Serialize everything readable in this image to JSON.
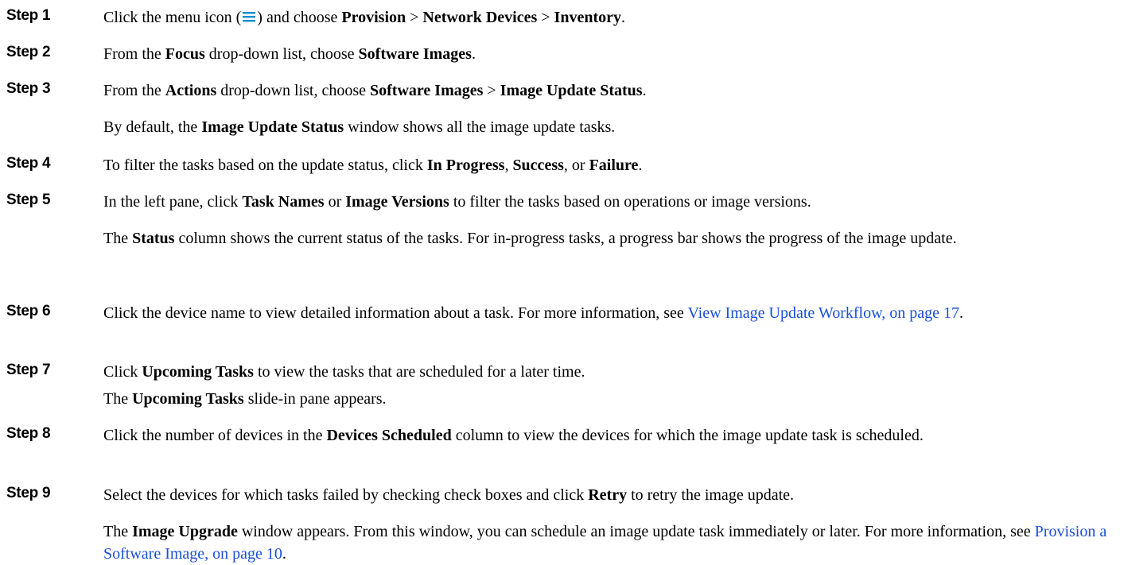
{
  "colors": {
    "text": "#000000",
    "link": "#1a4fd8",
    "menu_icon": "#0b8fd3"
  },
  "steps": [
    {
      "label": "Step 1",
      "p1": {
        "t1": "Click the menu icon (",
        "icon": "menu-icon",
        "t2": ") and choose ",
        "b1": "Provision",
        "t3": " > ",
        "b2": "Network Devices",
        "t4": " > ",
        "b3": "Inventory",
        "t5": "."
      }
    },
    {
      "label": "Step 2",
      "p1": {
        "t1": "From the ",
        "b1": "Focus",
        "t2": " drop-down list, choose ",
        "b2": "Software Images",
        "t3": "."
      }
    },
    {
      "label": "Step 3",
      "p1": {
        "t1": "From the ",
        "b1": "Actions",
        "t2": " drop-down list, choose ",
        "b2": "Software Images",
        "t3": " > ",
        "b3": "Image Update Status",
        "t4": "."
      },
      "p2": {
        "t1": "By default, the ",
        "b1": "Image Update Status",
        "t2": " window shows all the image update tasks."
      }
    },
    {
      "label": "Step 4",
      "p1": {
        "t1": "To filter the tasks based on the update status, click ",
        "b1": "In Progress",
        "t2": ", ",
        "b2": "Success",
        "t3": ", or ",
        "b3": "Failure",
        "t4": "."
      }
    },
    {
      "label": "Step 5",
      "p1": {
        "t1": "In the left pane, click ",
        "b1": "Task Names",
        "t2": " or ",
        "b2": "Image Versions",
        "t3": " to filter the tasks based on operations or image versions."
      },
      "p2": {
        "t1": "The ",
        "b1": "Status",
        "t2": " column shows the current status of the tasks. For in-progress tasks, a progress bar shows the progress of the image update."
      }
    },
    {
      "label": "Step 6",
      "p1": {
        "t1": "Click the device name to view detailed information about a task. For more information, see ",
        "link": "View Image Update Workflow, on page 17",
        "t2": "."
      }
    },
    {
      "label": "Step 7",
      "p1": {
        "t1": "Click ",
        "b1": "Upcoming Tasks",
        "t2": " to view the tasks that are scheduled for a later time."
      },
      "p2": {
        "t1": "The ",
        "b1": "Upcoming Tasks",
        "t2": " slide-in pane appears."
      }
    },
    {
      "label": "Step 8",
      "p1": {
        "t1": "Click the number of devices in the ",
        "b1": "Devices Scheduled",
        "t2": " column to view the devices for which the image update task is scheduled."
      }
    },
    {
      "label": "Step 9",
      "p1": {
        "t1": "Select the devices for which tasks failed by checking check boxes and click ",
        "b1": "Retry",
        "t2": " to retry the image update."
      },
      "p2": {
        "t1": "The ",
        "b1": "Image Upgrade",
        "t2": " window appears. From this window, you can schedule an image update task immediately or later. For more information, see ",
        "link": "Provision a Software Image, on page 10",
        "t3": "."
      }
    }
  ]
}
